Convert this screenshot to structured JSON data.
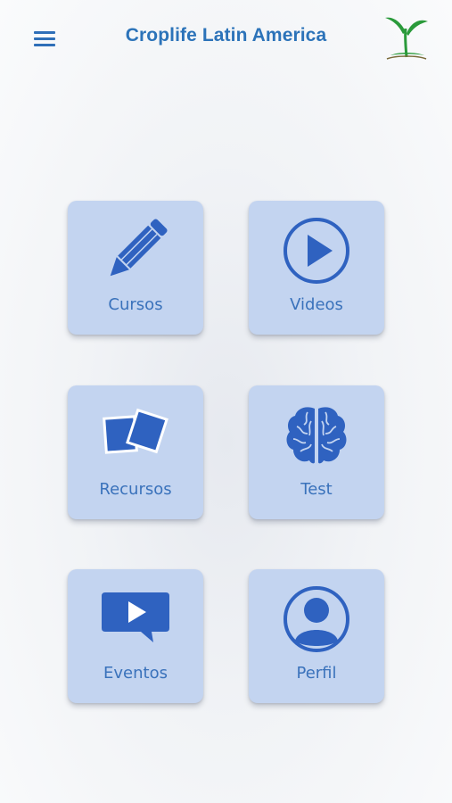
{
  "header": {
    "title": "Croplife Latin America",
    "menu_icon": "hamburger-menu-icon",
    "logo_icon": "sprout-logo-icon"
  },
  "tiles": [
    {
      "label": "Cursos",
      "icon": "pencil-icon"
    },
    {
      "label": "Videos",
      "icon": "play-circle-icon"
    },
    {
      "label": "Recursos",
      "icon": "photos-icon"
    },
    {
      "label": "Test",
      "icon": "brain-icon"
    },
    {
      "label": "Eventos",
      "icon": "video-chat-icon"
    },
    {
      "label": "Perfil",
      "icon": "user-profile-icon"
    }
  ],
  "colors": {
    "accent": "#2c73b9",
    "tile_bg": "#c3d4f0",
    "icon_blue": "#2f62c0",
    "logo_green": "#2a9a3a"
  }
}
